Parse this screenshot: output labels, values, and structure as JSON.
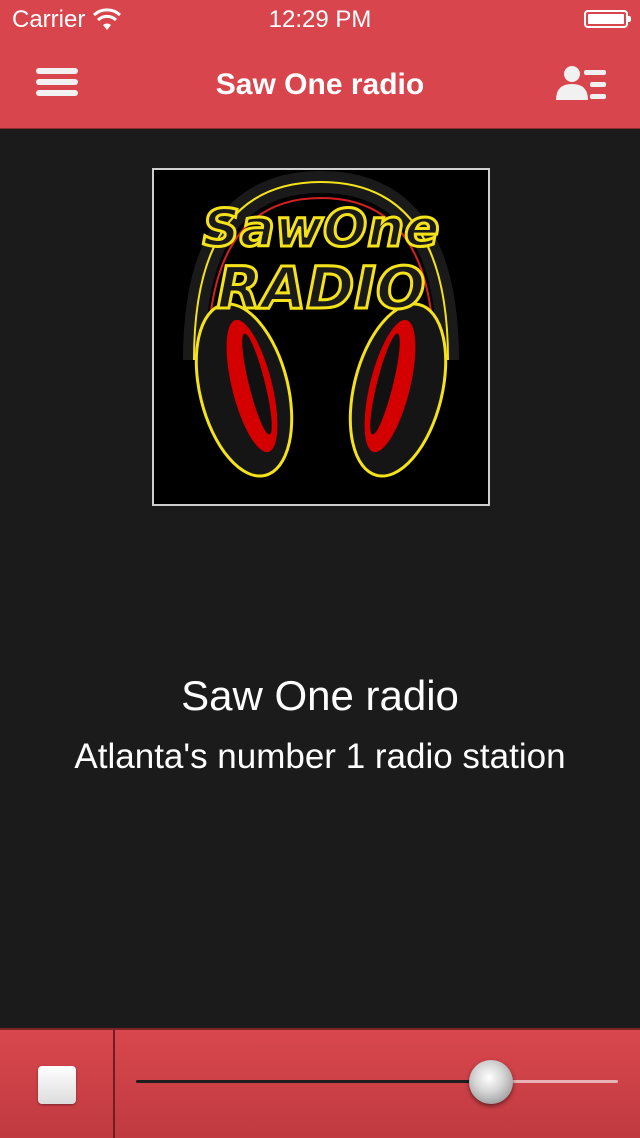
{
  "status_bar": {
    "carrier": "Carrier",
    "time": "12:29 PM",
    "wifi_icon": "wifi-icon",
    "battery_icon": "battery-icon"
  },
  "nav": {
    "title": "Saw One radio",
    "menu_icon": "hamburger-menu-icon",
    "contacts_icon": "contact-list-icon"
  },
  "artwork": {
    "logo_text_line1": "SawOne",
    "logo_text_line2": "RADIO",
    "graphic": "headphones-logo"
  },
  "station": {
    "name": "Saw One radio",
    "description": "Atlanta's number 1 radio station"
  },
  "player": {
    "stop_icon": "stop-icon",
    "volume_level": 0.72
  },
  "colors": {
    "bar_red": "#d8454c",
    "background": "#1b1b1b",
    "text": "#ffffff"
  }
}
